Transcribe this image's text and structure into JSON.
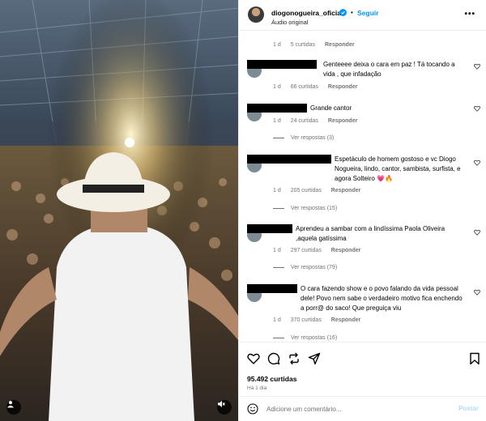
{
  "header": {
    "username": "diogonogueira_oficial",
    "dot": "•",
    "follow_label": "Seguir",
    "audio_label": "Áudio original",
    "more_icon": "more-horizontal-icon"
  },
  "top_meta": {
    "time": "1 d",
    "likes": "5 curtidas",
    "reply": "Responder"
  },
  "comments": [
    {
      "text": "Genteeee deixa o cara em paz ! Tá tocando a vida , que infadação",
      "time": "1 d",
      "likes": "66 curtidas",
      "reply": "Responder",
      "view_replies": ""
    },
    {
      "text": "Grande cantor",
      "time": "1 d",
      "likes": "24 curtidas",
      "reply": "Responder",
      "view_replies": "Ver respostas (3)"
    },
    {
      "text": "Espetáculo de homem gostoso e vc Diogo Nogueira, lindo, cantor, sambista, surfista, e agora Solteiro 💗🔥",
      "time": "1 d",
      "likes": "205 curtidas",
      "reply": "Responder",
      "view_replies": "Ver respostas (15)"
    },
    {
      "text": "Aprendeu a sambar com a lindíssima Paola Oliveira ,aquela gatíssima",
      "time": "1 d",
      "likes": "297 curtidas",
      "reply": "Responder",
      "view_replies": "Ver respostas (79)"
    },
    {
      "text": "O cara fazendo show e o povo falando da vida pessoal dele! Povo nem sabe o verdadeiro motivo fica enchendo a porr@ do saco! Que preguiça viu",
      "time": "1 d",
      "likes": "370 curtidas",
      "reply": "Responder",
      "view_replies": "Ver respostas (16)"
    }
  ],
  "actions": {
    "likes": "95.492 curtidas",
    "time_ago": "Há 1 dia"
  },
  "add_comment": {
    "placeholder": "Adicione um comentário...",
    "post_label": "Postar"
  },
  "colors": {
    "accent": "#0095f6",
    "muted": "#737373",
    "border": "#efefef"
  }
}
